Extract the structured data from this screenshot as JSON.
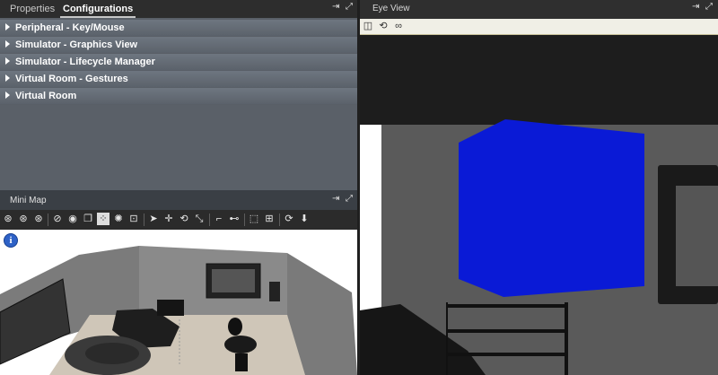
{
  "left_panel": {
    "tabs": [
      {
        "label": "Properties",
        "active": false
      },
      {
        "label": "Configurations",
        "active": true
      }
    ],
    "configurations": [
      {
        "label": "Peripheral - Key/Mouse"
      },
      {
        "label": "Simulator - Graphics View"
      },
      {
        "label": "Simulator - Lifecycle Manager"
      },
      {
        "label": "Virtual Room - Gestures"
      },
      {
        "label": "Virtual Room"
      }
    ]
  },
  "mini_map": {
    "title": "Mini Map",
    "info_glyph": "i",
    "toolbar": [
      "camera-orbit-icon",
      "camera-pan-icon",
      "camera-focus-icon",
      "visibility-toggle-icon",
      "record-icon",
      "window-icon",
      "grid-icon",
      "light-icon",
      "zoom-fit-icon",
      "select-arrow-icon",
      "move-icon",
      "rotate-icon",
      "scale-icon",
      "link-add-icon",
      "link-remove-icon",
      "bounding-box-icon",
      "center-icon",
      "reset-icon",
      "down-arrow-icon"
    ]
  },
  "eye_view": {
    "title": "Eye View",
    "toolbar": [
      "split-view-icon",
      "sync-icon",
      "link-icon"
    ]
  },
  "colors": {
    "panel_bg": "#595f67",
    "config_item": "#66707a",
    "eye_view_toolbar": "#f0efe6",
    "cube": "#0a1ad6",
    "info_icon": "#2e62c7"
  }
}
